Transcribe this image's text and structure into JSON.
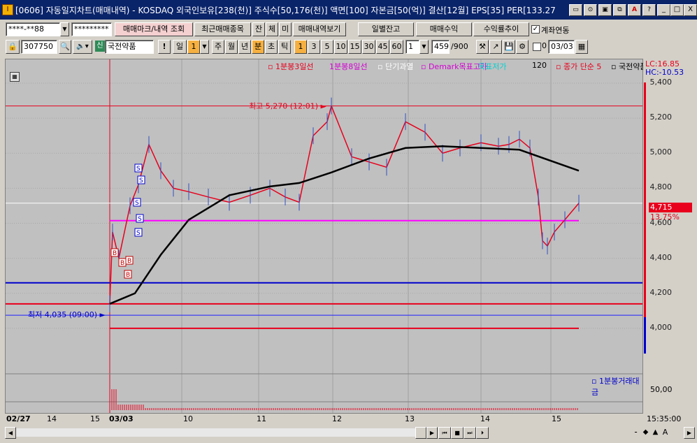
{
  "window": {
    "title": "[0606] 자동일지차트(매매내역) - KOSDAQ 외국인보유[238(천)] 주식수[50,176(천)] 액면[100] 자본금[50(억)] 결산[12월] EPS[35] PER[133.27",
    "app_icon": "I",
    "toolbar_icons": [
      "window-icon",
      "link-icon",
      "print-icon",
      "copy-icon",
      "a-icon",
      "help-icon"
    ],
    "toolbar_glyphs": [
      "▭",
      "⊙",
      "▣",
      "⧉",
      "A",
      "?"
    ],
    "min": "_",
    "max": "□",
    "close": "X"
  },
  "row1": {
    "account": "****-**88",
    "password": "*********",
    "trade_mark_btn": "매매마크/내역 조회",
    "recent_btn": "최근매매종목",
    "filter_btns": [
      "잔",
      "체",
      "미"
    ],
    "view_btn": "매매내역보기",
    "daily_balance_btn": "일별잔고",
    "profit_btn": "매매수익",
    "rate_btn": "수익률추이",
    "link_label": "계좌연동",
    "link_checked": "✓"
  },
  "row2": {
    "code": "307750",
    "badge": "신",
    "stock_name": "국전약품",
    "bang": "!",
    "period_day": "일",
    "period_value": "1",
    "periods": [
      "주",
      "월",
      "년",
      "분",
      "초",
      "틱"
    ],
    "minute_opts": [
      "1",
      "3",
      "5",
      "10",
      "15",
      "30",
      "45",
      "60"
    ],
    "minute_value": "1",
    "count": "459",
    "count_total": "/900",
    "date": "03/03"
  },
  "legend": [
    {
      "text": "▫ 1분봉3일선",
      "color": "#e8001c"
    },
    {
      "text": "1분봉8일선",
      "color": "#d400d4"
    },
    {
      "text": "▫ 단기과열",
      "color": "#ffffff"
    },
    {
      "text": "▫ Demark목표고가",
      "color": "#d400d4"
    },
    {
      "text": "목표저가",
      "color": "#00d0d0"
    },
    {
      "text": "120",
      "color": "#000000"
    },
    {
      "text": "▫ 종가 단순 5",
      "color": "#e8001c"
    },
    {
      "text": "▫ 국전약품",
      "color": "#000000"
    }
  ],
  "lc_hc": {
    "lc": "LC:16.85",
    "hc": "HC:-10.53"
  },
  "high_annot": "최고 5,270 (12:01)",
  "low_annot": "최저 4,035 (09:00)",
  "current_price": "4,715",
  "current_pct": "13.75%",
  "volume_label": "▫ 1분봉거래대금",
  "volume_axis": "50,00",
  "time_label": "15:35:00",
  "trade_marks": {
    "buy": "B",
    "sell": "S"
  },
  "x_labels": [
    "02/27",
    "14",
    "15",
    "03/03",
    "10",
    "11",
    "12",
    "13",
    "14",
    "15"
  ],
  "scroll_btns": [
    "◀",
    "▶",
    "⏮",
    "■",
    "⏭",
    "⏵"
  ],
  "zoom_btns": [
    "-",
    "◆",
    "▲",
    "A",
    "▶"
  ],
  "colors": {
    "price_line": "#e8001c",
    "ma120": "#000000",
    "blue_line": "#0000cc",
    "magenta_line": "#ff00ff",
    "bg": "#c0c0c0"
  },
  "chart_data": {
    "type": "line",
    "title": "",
    "series": [
      {
        "name": "국전약품",
        "x": [
          "02/27",
          "15",
          "03/03 09:00",
          "09:05",
          "09:10",
          "09:20",
          "09:30",
          "09:40",
          "09:50",
          "10:00",
          "10:10",
          "10:20",
          "10:30",
          "10:45",
          "11:00",
          "11:15",
          "11:30",
          "11:45",
          "12:00",
          "12:01",
          "12:15",
          "12:30",
          "12:45",
          "13:00",
          "13:15",
          "13:30",
          "13:45",
          "14:00",
          "14:15",
          "14:30",
          "14:45",
          "14:50",
          "15:00",
          "15:05",
          "15:10",
          "15:15",
          "15:20",
          "15:30"
        ],
        "values": [
          4140,
          4140,
          4140,
          4550,
          4400,
          4700,
          4820,
          5050,
          4900,
          4800,
          4780,
          4750,
          4720,
          4760,
          4800,
          4750,
          4720,
          5100,
          5180,
          5270,
          4980,
          4950,
          4920,
          5180,
          5120,
          5000,
          5030,
          5060,
          5040,
          5050,
          5080,
          5030,
          4750,
          4500,
          4470,
          4550,
          4620,
          4715
        ]
      },
      {
        "name": "120",
        "x": [
          "03/03 09:00",
          "09:30",
          "10:00",
          "10:30",
          "11:00",
          "11:30",
          "12:00",
          "12:30",
          "13:00",
          "13:30",
          "14:00",
          "14:30",
          "15:00",
          "15:30"
        ],
        "values": [
          4140,
          4200,
          4420,
          4620,
          4760,
          4810,
          4830,
          4890,
          4970,
          5030,
          5040,
          5030,
          5020,
          4900
        ]
      }
    ],
    "ylabels": [
      "4,000",
      "4,200",
      "4,400",
      "4,600",
      "4,800",
      "5,000",
      "5,200",
      "5,400"
    ],
    "ylim": [
      3860,
      5440
    ],
    "reference_lines": {
      "high": 5270,
      "low": 4035,
      "blue": 4260,
      "magenta": 4615,
      "red": 4140
    }
  }
}
